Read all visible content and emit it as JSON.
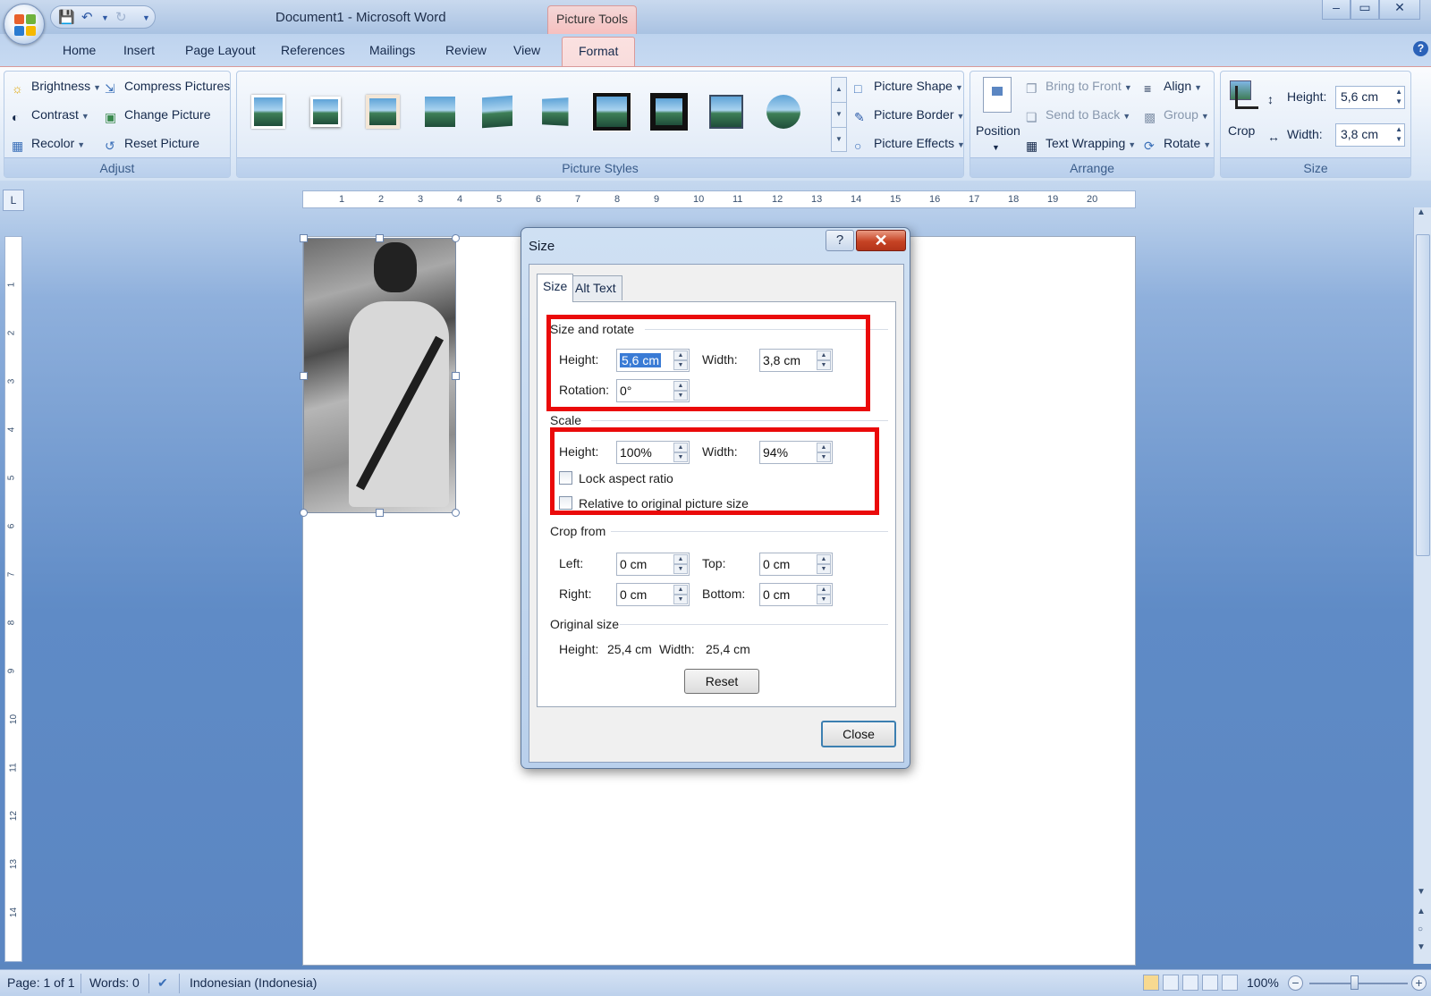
{
  "window": {
    "title": "Document1 - Microsoft Word",
    "context_tab": "Picture Tools",
    "controls": [
      "–",
      "▭",
      "✕"
    ]
  },
  "tabs": [
    "Home",
    "Insert",
    "Page Layout",
    "References",
    "Mailings",
    "Review",
    "View",
    "Format"
  ],
  "active_tab": "Format",
  "ribbon": {
    "adjust": {
      "label": "Adjust",
      "brightness": "Brightness",
      "contrast": "Contrast",
      "recolor": "Recolor",
      "compress": "Compress Pictures",
      "change": "Change Picture",
      "reset": "Reset Picture"
    },
    "picture_styles": {
      "label": "Picture Styles",
      "shape": "Picture Shape",
      "border": "Picture Border",
      "effects": "Picture Effects"
    },
    "arrange": {
      "label": "Arrange",
      "position": "Position",
      "bring_front": "Bring to Front",
      "send_back": "Send to Back",
      "text_wrapping": "Text Wrapping",
      "align": "Align",
      "group": "Group",
      "rotate": "Rotate"
    },
    "size": {
      "label": "Size",
      "crop": "Crop",
      "height_label": "Height:",
      "height_value": "5,6 cm",
      "width_label": "Width:",
      "width_value": "3,8 cm"
    }
  },
  "ruler": {
    "h_ticks": [
      "1",
      "2",
      "3",
      "4",
      "5",
      "6",
      "7",
      "8",
      "9",
      "10",
      "11",
      "12",
      "13",
      "14",
      "15",
      "16",
      "17",
      "18",
      "19",
      "20"
    ],
    "v_ticks": [
      "1",
      "2",
      "3",
      "4",
      "5",
      "6",
      "7",
      "8",
      "9",
      "10",
      "11",
      "12",
      "13",
      "14"
    ],
    "corner": "L"
  },
  "dialog": {
    "title": "Size",
    "help": "?",
    "close_x": "✕",
    "tabs": [
      "Size",
      "Alt Text"
    ],
    "size_rotate": {
      "header": "Size and rotate",
      "height_label": "Height:",
      "height_value": "5,6 cm",
      "width_label": "Width:",
      "width_value": "3,8 cm",
      "rotation_label": "Rotation:",
      "rotation_value": "0°"
    },
    "scale": {
      "header": "Scale",
      "height_label": "Height:",
      "height_value": "100%",
      "width_label": "Width:",
      "width_value": "94%",
      "lock_aspect": "Lock aspect ratio",
      "lock_aspect_checked": false,
      "relative": "Relative to original picture size",
      "relative_checked": false
    },
    "crop": {
      "header": "Crop from",
      "left_label": "Left:",
      "left_value": "0 cm",
      "top_label": "Top:",
      "top_value": "0 cm",
      "right_label": "Right:",
      "right_value": "0 cm",
      "bottom_label": "Bottom:",
      "bottom_value": "0 cm"
    },
    "original": {
      "header": "Original size",
      "height_label": "Height:",
      "height_value": "25,4 cm",
      "width_label": "Width:",
      "width_value": "25,4 cm"
    },
    "reset_button": "Reset",
    "close_button": "Close"
  },
  "statusbar": {
    "page": "Page: 1 of 1",
    "words": "Words: 0",
    "language": "Indonesian (Indonesia)",
    "zoom": "100%"
  },
  "colors": {
    "highlight_box": "#ea0a0a",
    "format_tab": "#f8dcdc",
    "workspace": "#5b86c2"
  }
}
